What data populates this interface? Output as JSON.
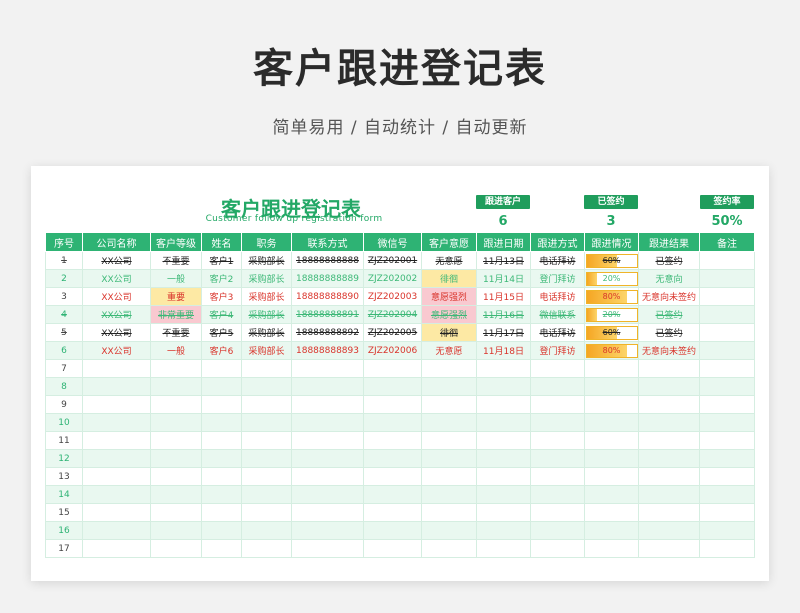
{
  "header": {
    "title": "客户跟进登记表",
    "subtitle": "简单易用 / 自动统计 / 自动更新"
  },
  "sheet": {
    "title": "客户跟进登记表",
    "subtitle_en": "Customer follow up registration form",
    "stats": [
      {
        "label": "跟进客户",
        "value": "6"
      },
      {
        "label": "已签约",
        "value": "3"
      },
      {
        "label": "签约率",
        "value": "50%"
      }
    ],
    "columns": [
      "序号",
      "公司名称",
      "客户等级",
      "姓名",
      "职务",
      "联系方式",
      "微信号",
      "客户意愿",
      "跟进日期",
      "跟进方式",
      "跟进情况",
      "跟进结果",
      "备注"
    ],
    "rows": [
      {
        "no": "1",
        "company": "XX公司",
        "level": "不重要",
        "name": "客户1",
        "role": "采购部长",
        "phone": "18888888888",
        "wechat": "ZJZ202001",
        "intent": "无意愿",
        "date": "11月13日",
        "method": "电话拜访",
        "progress": 0.6,
        "progress_text": "60%",
        "result": "已签约",
        "note": "",
        "style": "done",
        "level_hl": "",
        "intent_hl": ""
      },
      {
        "no": "2",
        "company": "XX公司",
        "level": "一般",
        "name": "客户2",
        "role": "采购部长",
        "phone": "18888888889",
        "wechat": "ZJZ202002",
        "intent": "徘徊",
        "date": "11月14日",
        "method": "登门拜访",
        "progress": 0.2,
        "progress_text": "20%",
        "result": "无意向",
        "note": "",
        "style": "green",
        "level_hl": "",
        "intent_hl": "wait"
      },
      {
        "no": "3",
        "company": "XX公司",
        "level": "重要",
        "name": "客户3",
        "role": "采购部长",
        "phone": "18888888890",
        "wechat": "ZJZ202003",
        "intent": "意愿强烈",
        "date": "11月15日",
        "method": "电话拜访",
        "progress": 0.8,
        "progress_text": "80%",
        "result": "无意向未签约",
        "note": "",
        "style": "red",
        "level_hl": "imp",
        "intent_hl": "strong"
      },
      {
        "no": "4",
        "company": "XX公司",
        "level": "非常重要",
        "name": "客户4",
        "role": "采购部长",
        "phone": "18888888891",
        "wechat": "ZJZ202004",
        "intent": "意愿强烈",
        "date": "11月16日",
        "method": "微信联系",
        "progress": 0.2,
        "progress_text": "20%",
        "result": "已签约",
        "note": "",
        "style": "greenstrike",
        "level_hl": "vimp",
        "intent_hl": "strong"
      },
      {
        "no": "5",
        "company": "XX公司",
        "level": "不重要",
        "name": "客户5",
        "role": "采购部长",
        "phone": "18888888892",
        "wechat": "ZJZ202005",
        "intent": "徘徊",
        "date": "11月17日",
        "method": "电话拜访",
        "progress": 0.6,
        "progress_text": "60%",
        "result": "已签约",
        "note": "",
        "style": "done",
        "level_hl": "",
        "intent_hl": "wait"
      },
      {
        "no": "6",
        "company": "XX公司",
        "level": "一般",
        "name": "客户6",
        "role": "采购部长",
        "phone": "18888888893",
        "wechat": "ZJZ202006",
        "intent": "无意愿",
        "date": "11月18日",
        "method": "登门拜访",
        "progress": 0.8,
        "progress_text": "80%",
        "result": "无意向未签约",
        "note": "",
        "style": "red",
        "level_hl": "",
        "intent_hl": ""
      }
    ],
    "empty_row_numbers": [
      "7",
      "8",
      "9",
      "10",
      "11",
      "12",
      "13",
      "14",
      "15",
      "16",
      "17"
    ]
  },
  "colors": {
    "accent": "#2eb374",
    "title_green": "#23a866",
    "red": "#d9342b",
    "highlight_yellow": "#fde9a4",
    "highlight_pink": "#f9c9d0"
  }
}
